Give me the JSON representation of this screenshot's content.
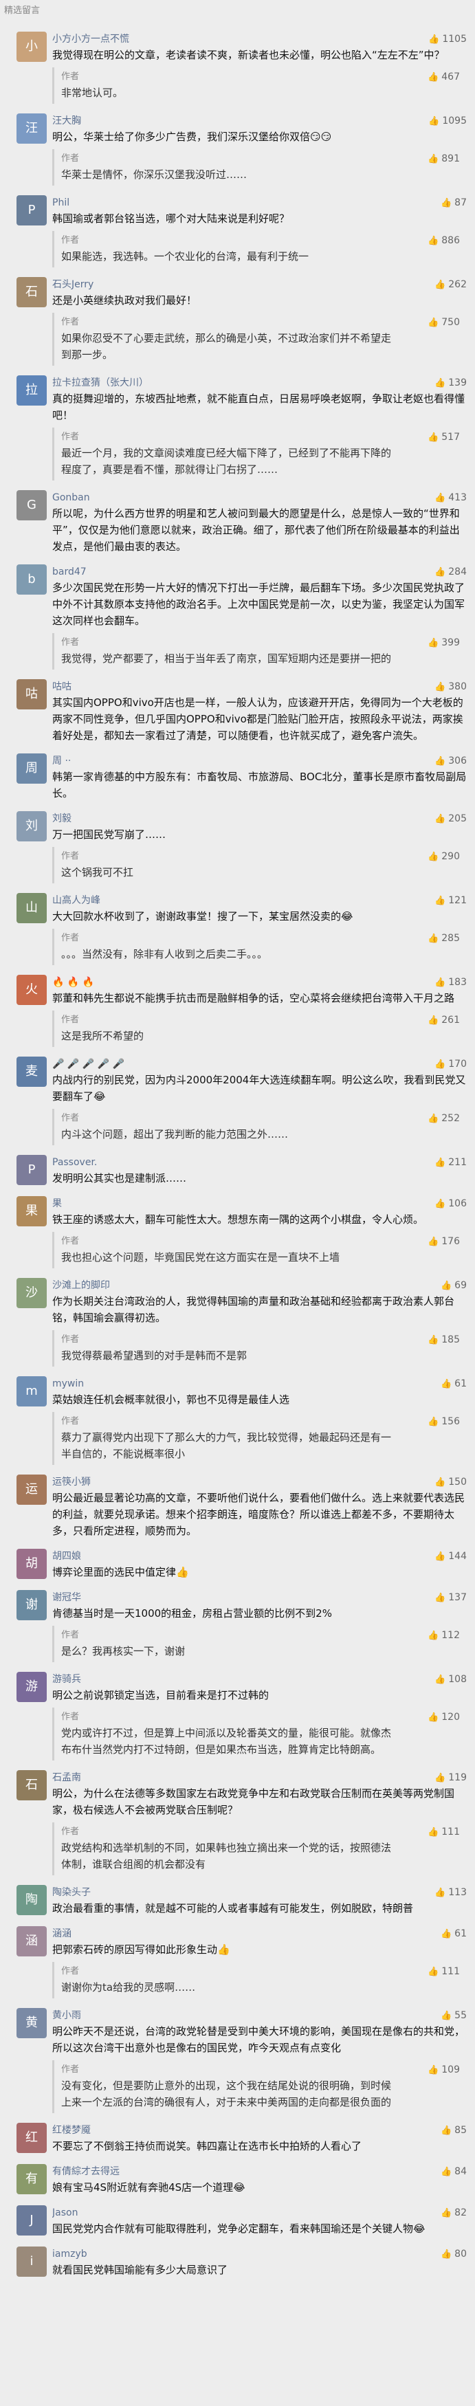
{
  "header": {
    "title": "精选留言"
  },
  "like_icon": "thumbs-up-icon",
  "comments": [
    {
      "user": "小方小方一点不慌",
      "avatar": "小",
      "color": "#c9a27a",
      "likes": "1105",
      "text": "我觉得现在明公的文章，老读者读不爽，新读者也未必懂，明公也陷入“左左不左”中？",
      "reply": {
        "label": "作者",
        "likes": "467",
        "text": "非常地认可。"
      }
    },
    {
      "user": "汪大胸",
      "avatar": "汪",
      "color": "#7b9ac4",
      "likes": "1095",
      "text": "明公，华莱士给了你多少广告费，我们深乐汉堡给你双倍😏😏",
      "reply": {
        "label": "作者",
        "likes": "891",
        "text": "华莱士是情怀，你深乐汉堡我没听过……"
      }
    },
    {
      "user": "Phil",
      "avatar": "P",
      "color": "#6a7f99",
      "likes": "87",
      "text": "韩国瑜或者郭台铭当选，哪个对大陆来说是利好呢？",
      "reply": {
        "label": "作者",
        "likes": "886",
        "text": "如果能选，我选韩。一个农业化的台湾，最有利于统一"
      }
    },
    {
      "user": "石头Jerry",
      "avatar": "石",
      "color": "#a38a6b",
      "likes": "262",
      "text": "还是小英继续执政对我们最好！",
      "reply": {
        "label": "作者",
        "likes": "750",
        "text": "如果你忍受不了心要走武统，那么的确是小英，不过政治家们并不希望走到那一步。"
      }
    },
    {
      "user": "拉卡拉查猜（张大川）",
      "avatar": "拉",
      "color": "#5d84b8",
      "likes": "139",
      "text": "真的挺舞迎增的，东坡西扯地煮，就不能直白点，日居易呼唤老妪啊，争取让老妪也看得懂吧！",
      "reply": {
        "label": "作者",
        "likes": "517",
        "text": "最近一个月，我的文章阅读难度已经大幅下降了，已经到了不能再下降的程度了，真要是看不懂，那就得让门右拐了……"
      }
    },
    {
      "user": "Gonban",
      "avatar": "G",
      "color": "#8c8c8c",
      "likes": "413",
      "text": "所以呢，为什么西方世界的明星和艺人被问到最大的愿望是什么，总是惊人一致的“世界和平”，仅仅是为他们意愿以就来，政治正确。细了，那代表了他们所在阶级最基本的利益出发点，是他们最由衷的表达。",
      "reply": null
    },
    {
      "user": "bard47",
      "avatar": "b",
      "color": "#7f9bb0",
      "likes": "284",
      "text": "多少次国民党在形势一片大好的情况下打出一手烂牌，最后翻车下场。多少次国民党执政了中外不计其数原本支持他的政治名手。上次中国民党是前一次，以史为鉴，我坚定认为国军这次同样也会翻车。",
      "reply": {
        "label": "作者",
        "likes": "399",
        "text": "我觉得，党产都要了，相当于当年丢了南京，国军短期内还是要拼一把的"
      }
    },
    {
      "user": "咕咕",
      "avatar": "咕",
      "color": "#9a7b5e",
      "likes": "380",
      "text": "其实国内OPPO和vivo开店也是一样，一般人认为，应该避开开店，免得同为一个大老板的两家不同性竞争，但几乎国内OPPO和vivo都是门脸贴门脸开店，按照段永平说法，两家挨着好处是，都知去一家看过了清楚，可以随便看，也许就买成了，避免客户流失。",
      "reply": null
    },
    {
      "user": "周 ··",
      "avatar": "周",
      "color": "#6d89a8",
      "likes": "306",
      "text": "韩第一家肯德基的中方股东有：市畜牧局、市旅游局、BOC北分，董事长是原市畜牧局副局长。",
      "reply": null
    },
    {
      "user": "刘毅",
      "avatar": "刘",
      "color": "#8a9db2",
      "likes": "205",
      "text": "万一把国民党写崩了……",
      "reply": {
        "label": "作者",
        "likes": "290",
        "text": "这个锅我可不扛"
      }
    },
    {
      "user": "山高人为峰",
      "avatar": "山",
      "color": "#7a8f6a",
      "likes": "121",
      "text": "大大回款水杯收到了，谢谢政事堂！搜了一下，某宝居然没卖的😂",
      "reply": {
        "label": "作者",
        "likes": "285",
        "text": "。。。当然没有，除非有人收到之后卖二手。。。"
      }
    },
    {
      "user": "🔥 🔥 🔥",
      "avatar": "火",
      "color": "#c96a4a",
      "likes": "183",
      "text": "郭董和韩先生都说不能携手抗击而是融鲜相争的话，空心菜将会继续把台湾带入干月之路",
      "reply": {
        "label": "作者",
        "likes": "261",
        "text": "这是我所不希望的"
      }
    },
    {
      "user": "🎤 🎤 🎤 🎤 🎤",
      "avatar": "麦",
      "color": "#5f7ea6",
      "likes": "170",
      "text": "内战内行的别民党，因为内斗2000年2004年大选连续翻车啊。明公这么吹，我看到民党又要翻车了😂",
      "reply": {
        "label": "作者",
        "likes": "252",
        "text": "内斗这个问题，超出了我判断的能力范围之外……"
      }
    },
    {
      "user": "Passover.",
      "avatar": "P",
      "color": "#7c7c9a",
      "likes": "211",
      "text": "发明明公其实也是建制派……",
      "reply": null
    },
    {
      "user": "果",
      "avatar": "果",
      "color": "#b08a5a",
      "likes": "106",
      "text": "铁王座的诱惑太大，翻车可能性太大。想想东南一隅的这两个小棋盘，令人心烦。",
      "reply": {
        "label": "作者",
        "likes": "176",
        "text": "我也担心这个问题，毕竟国民党在这方面实在是一直块不上墙"
      }
    },
    {
      "user": "沙滩上的脚印",
      "avatar": "沙",
      "color": "#8aa07a",
      "likes": "69",
      "text": "作为长期关注台湾政治的人，我觉得韩国瑜的声量和政治基础和经验都离于政治素人郭台铭，韩国瑜会赢得初选。",
      "reply": {
        "label": "作者",
        "likes": "185",
        "text": "我觉得蔡最希望遇到的对手是韩而不是郭"
      }
    },
    {
      "user": "mywin",
      "avatar": "m",
      "color": "#6f8fb5",
      "likes": "61",
      "text": "菜姑娘连任机会概率就很小，郭也不见得是最佳人选",
      "reply": {
        "label": "作者",
        "likes": "156",
        "text": "蔡力了嬴得党内出现下了那么大的力气，我比较觉得，她最起码还是有一半自信的，不能说概率很小"
      }
    },
    {
      "user": "运筷小狮",
      "avatar": "运",
      "color": "#a5785a",
      "likes": "150",
      "text": "明公最近最显著论功高的文章，不要听他们说什么，要看他们做什么。选上来就要代表选民的利益，就要兑现承诺。想来个招李朗连，暗度陈仓？所以谁选上都差不多，不要期待太多，只看所定进程，顺势而为。",
      "reply": null
    },
    {
      "user": "胡四娘",
      "avatar": "胡",
      "color": "#9b6f8a",
      "likes": "144",
      "text": "博弈论里面的选民中值定律👍",
      "reply": null
    },
    {
      "user": "谢冠华",
      "avatar": "谢",
      "color": "#6a8aa0",
      "likes": "137",
      "text": "肯德基当时是一天1000的租金，房租占营业额的比例不到2%",
      "reply": {
        "label": "作者",
        "likes": "112",
        "text": "是么？我再核实一下，谢谢"
      }
    },
    {
      "user": "游骑兵",
      "avatar": "游",
      "color": "#7a6a9a",
      "likes": "108",
      "text": "明公之前说郭锁定当选，目前看来是打不过韩的",
      "reply": {
        "label": "作者",
        "likes": "120",
        "text": "党内或许打不过，但是算上中间派以及轮番英文的量，能很可能。就像杰布布什当然党内打不过特朗，但是如果杰布当选，胜算肯定比特朗高。"
      }
    },
    {
      "user": "石孟南",
      "avatar": "石",
      "color": "#8f7c5c",
      "likes": "119",
      "text": "明公，为什么在法德等多数国家左右政党竞争中左和右政党联合压制而在英美等两党制国家，极右候选人不会被两党联合压制呢？",
      "reply": {
        "label": "作者",
        "likes": "111",
        "text": "政党结构和选举机制的不同，如果韩也独立摘出来一个党的话，按照德法体制，谁联合组阁的机会都没有"
      }
    },
    {
      "user": "陶染头子",
      "avatar": "陶",
      "color": "#6f9a8a",
      "likes": "113",
      "text": "政治最看重的事情，就是越不可能的人或者事越有可能发生，例如脱欧，特朗普",
      "reply": null
    },
    {
      "user": "涵涵",
      "avatar": "涵",
      "color": "#a08a9a",
      "likes": "61",
      "text": "把郭索石砖的原因写得如此形象生动👍",
      "reply": {
        "label": "作者",
        "likes": "111",
        "text": "谢谢你为ta给我的灵感啊……"
      }
    },
    {
      "user": "黄小雨",
      "avatar": "黄",
      "color": "#7a8aa5",
      "likes": "55",
      "text": "明公昨天不是还说，台湾的政党轮替是受到中美大环境的影响，美国现在是像右的共和党，所以这次台湾干出意外也是像右的国民党，咋今天观点有点变化",
      "reply": {
        "label": "作者",
        "likes": "109",
        "text": "没有变化，但是要防止意外的出现，这个我在结尾处说的很明确，到时候上来一个左派的台湾的确很有人，对于未来中美两国的走向都是很负面的"
      }
    },
    {
      "user": "红楼梦魇",
      "avatar": "红",
      "color": "#a86a6a",
      "likes": "85",
      "text": "不要忘了不倒翁王持侦而说笑。韩四嘉让在选市长中拍矫的人看心了",
      "reply": null
    },
    {
      "user": "有倩綜才去得远",
      "avatar": "有",
      "color": "#8a9a6a",
      "likes": "84",
      "text": "娘有宝马4S附近就有奔驰4S店一个道理😂",
      "reply": null
    },
    {
      "user": "Jason",
      "avatar": "J",
      "color": "#6a7a9a",
      "likes": "82",
      "text": "国民党党内合作就有可能取得胜利，党争必定翻车，看来韩国瑜还是个关键人物😂",
      "reply": null
    },
    {
      "user": "iamzyb",
      "avatar": "i",
      "color": "#9a8a7a",
      "likes": "80",
      "text": "就看国民党韩国瑜能有多少大局意识了",
      "reply": null
    }
  ]
}
